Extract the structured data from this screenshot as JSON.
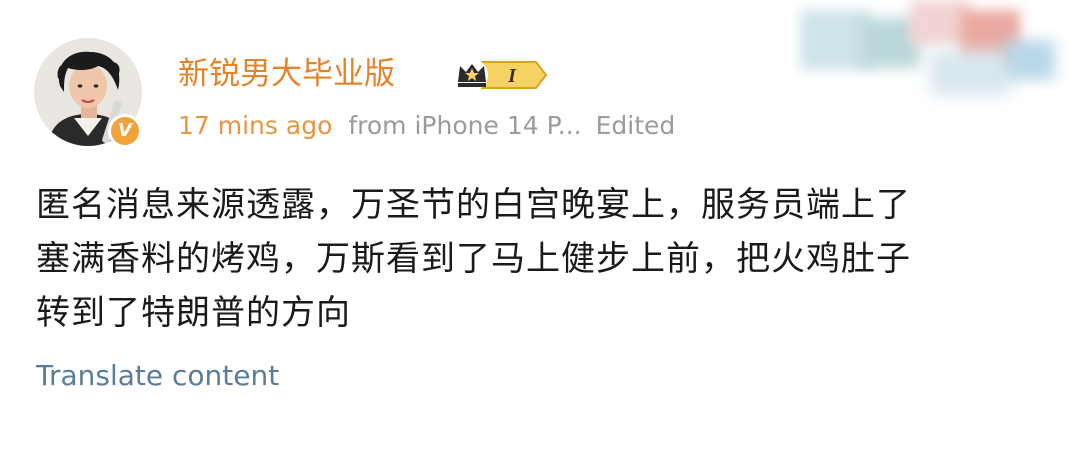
{
  "post": {
    "username": "新锐男大毕业版",
    "level_badge": "I",
    "timestamp": "17 mins ago",
    "source": "from iPhone 14 P...",
    "edited": "Edited",
    "content_lines": [
      "匿名消息来源透露，万圣节的白宫晚宴上，服务员端上了",
      "塞满香料的烤鸡，万斯看到了马上健步上前，把火鸡肚子",
      "转到了特朗普的方向"
    ],
    "translate_label": "Translate content",
    "verified_badge": "V"
  },
  "colors": {
    "username": "#e5832a",
    "timestamp": "#e89540",
    "meta_gray": "#9b9b9b",
    "content_text": "#1a1a1a",
    "translate_link": "#5c7d97",
    "verified_badge": "#f0a33a",
    "level_badge_gold": "#f2c94c"
  },
  "icons": {
    "avatar": "user-avatar-photo",
    "verified": "verified-v-icon",
    "level": "crown-level-icon"
  }
}
